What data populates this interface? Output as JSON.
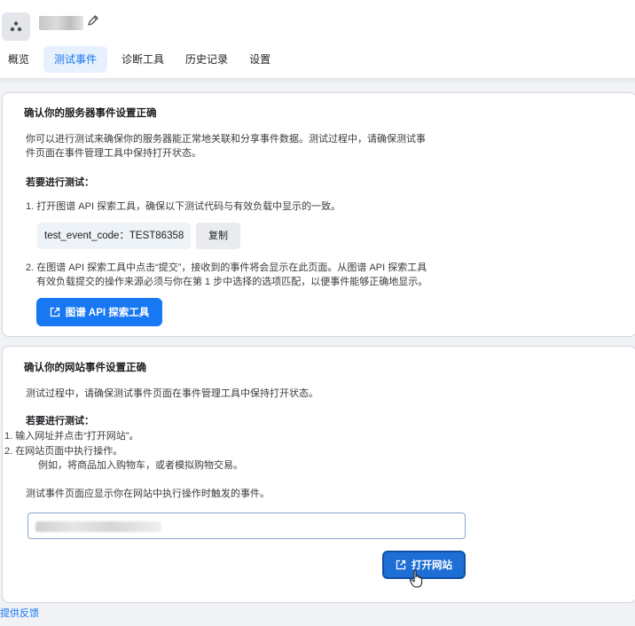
{
  "header": {
    "pixel_icon": "pixel-icon",
    "edit_icon": "pencil-icon"
  },
  "tabs": [
    {
      "label": "概览",
      "active": false
    },
    {
      "label": "测试事件",
      "active": true
    },
    {
      "label": "诊断工具",
      "active": false
    },
    {
      "label": "历史记录",
      "active": false
    },
    {
      "label": "设置",
      "active": false
    }
  ],
  "server_section": {
    "title": "确认你的服务器事件设置正确",
    "intro_line1": "你可以进行测试来确保你的服务器能正常地关联和分享事件数据。测试过程中，请确保测试事",
    "intro_line2": "件页面在事件管理工具中保持打开状态。",
    "steps_heading": "若要进行测试：",
    "step1": "1. 打开图谱 API 探索工具，确保以下测试代码与有效负载中显示的一致。",
    "test_code": "test_event_code：TEST86358",
    "copy_label": "复制",
    "step2_line1": "2. 在图谱 API 探索工具中点击“提交”，接收到的事件将会显示在此页面。从图谱 API 探索工具",
    "step2_line2": "有效负载提交的操作来源必须与你在第 1 步中选择的选项匹配，以便事件能够正确地显示。",
    "graph_button_label": "图谱 API 探索工具",
    "button_icon": "external-link-icon"
  },
  "website_section": {
    "title": "确认你的网站事件设置正确",
    "intro": "测试过程中，请确保测试事件页面在事件管理工具中保持打开状态。",
    "steps_heading": "若要进行测试：",
    "step1": "1.  输入网址并点击“打开网站”。",
    "step2_line1": "2.  在网站页面中执行操作。",
    "step2_line2": "例如，将商品加入购物车，或者模拟购物交易。",
    "note": "测试事件页面应显示你在网站中执行操作时触发的事件。",
    "open_button_label": "打开网站",
    "button_icon": "external-link-icon"
  },
  "footer": {
    "feedback_label": "提供反馈"
  },
  "colors": {
    "accent": "#1877f2",
    "tab_active_bg": "#e7f0fd",
    "page_bg": "#f0f2f5"
  }
}
